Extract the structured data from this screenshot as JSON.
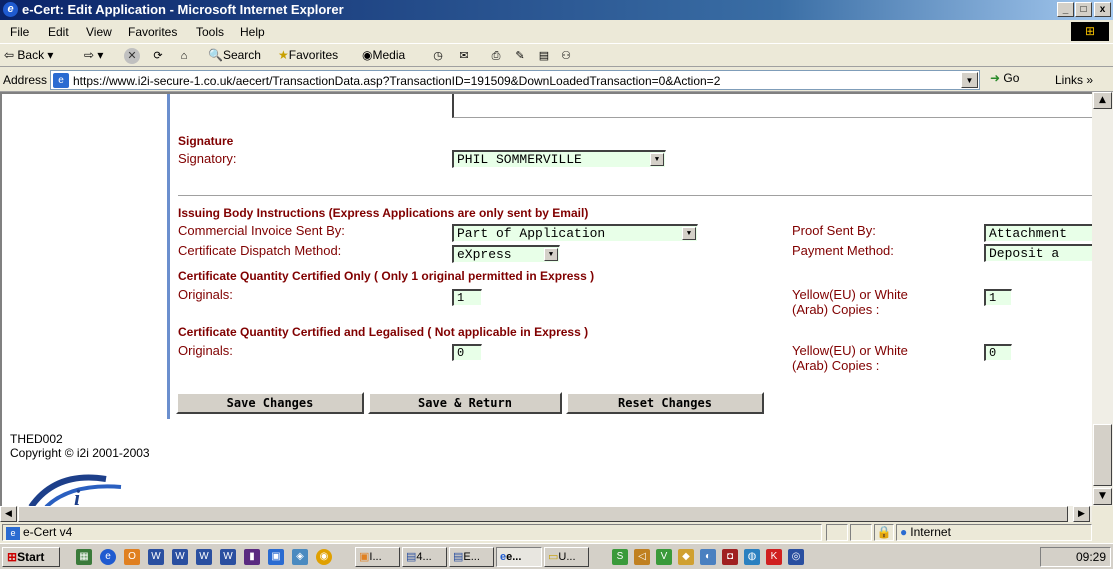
{
  "window": {
    "title": "e-Cert: Edit Application - Microsoft Internet Explorer",
    "controls": {
      "minimize": "_",
      "maximize": "□",
      "close": "x"
    }
  },
  "menu": [
    "File",
    "Edit",
    "View",
    "Favorites",
    "Tools",
    "Help"
  ],
  "toolbar": {
    "back": "Back",
    "search": "Search",
    "favorites": "Favorites",
    "media": "Media"
  },
  "address": {
    "label": "Address",
    "url": "https://www.i2i-secure-1.co.uk/aecert/TransactionData.asp?TransactionID=191509&DownLoadedTransaction=0&Action=2",
    "go": "Go",
    "links": "Links »"
  },
  "form": {
    "signature": {
      "heading": "Signature",
      "signatory_label": "Signatory:",
      "signatory_value": "PHIL SOMMERVILLE"
    },
    "issuing": {
      "heading": "Issuing Body Instructions (Express Applications are only sent by Email)",
      "commercial_invoice_label": "Commercial Invoice Sent By:",
      "commercial_invoice_value": "Part of Application",
      "proof_label": "Proof Sent By:",
      "proof_value": "Attachment",
      "dispatch_label": "Certificate Dispatch Method:",
      "dispatch_value": "eXpress",
      "payment_label": "Payment Method:",
      "payment_value": "Deposit a"
    },
    "certified_only": {
      "heading": "Certificate Quantity Certified Only ( Only 1 original permitted in Express )",
      "originals_label": "Originals:",
      "originals_value": "1",
      "copies_label_1": "Yellow(EU) or White",
      "copies_label_2": "(Arab) Copies :",
      "copies_value": "1"
    },
    "legalised": {
      "heading": "Certificate Quantity Certified and Legalised ( Not applicable in Express )",
      "originals_label": "Originals:",
      "originals_value": "0",
      "copies_label_1": "Yellow(EU) or White",
      "copies_label_2": "(Arab) Copies :",
      "copies_value": "0"
    },
    "buttons": {
      "save": "Save Changes",
      "save_return": "Save & Return",
      "reset": "Reset Changes"
    }
  },
  "footer": {
    "code": "THED002",
    "copyright": "Copyright © i2i 2001-2003"
  },
  "statusbar": {
    "text": "e-Cert v4",
    "zone": "Internet"
  },
  "taskbar": {
    "start": "Start",
    "tasks": [
      "I...",
      "4...",
      "E...",
      "e...",
      "U..."
    ],
    "clock": "09:29"
  },
  "colors": {
    "label": "#800000",
    "field_bg": "#e8ffe8",
    "accent_bar": "#6b8fce"
  }
}
